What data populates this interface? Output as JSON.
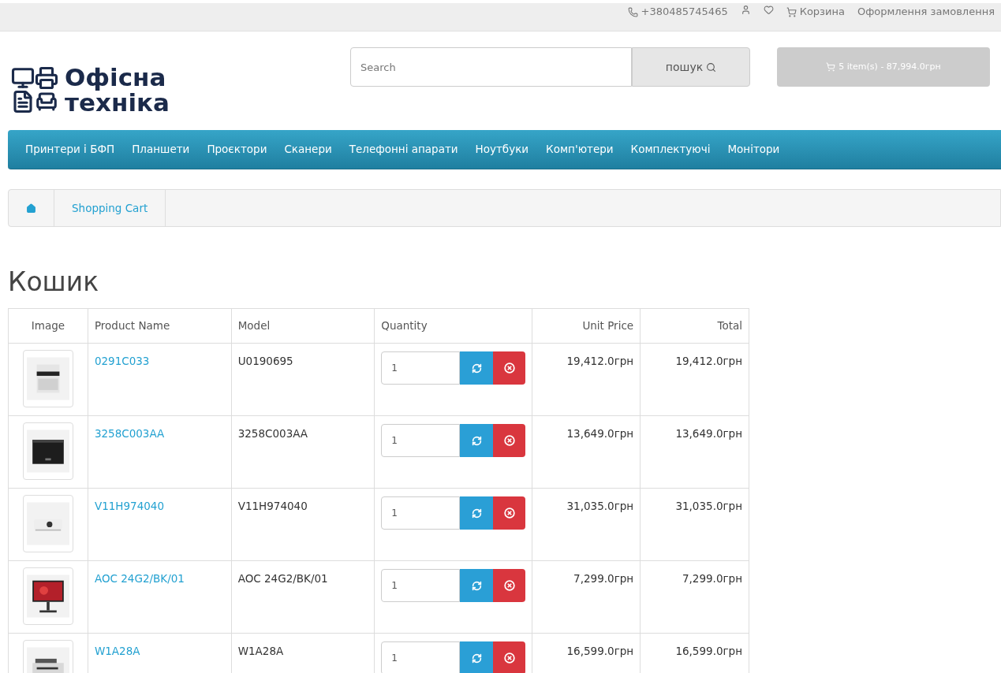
{
  "top_links": [
    {
      "kind": "phone",
      "label": "+380485745465"
    },
    {
      "kind": "account"
    },
    {
      "kind": "wishlist"
    },
    {
      "kind": "cart",
      "label": "Корзина"
    },
    {
      "kind": "checkout",
      "label": "Оформлення замовлення"
    }
  ],
  "logo": {
    "line1": "Офісна",
    "line2": "техніка"
  },
  "search": {
    "placeholder": "Search",
    "button": "пошук"
  },
  "cart_button": "5 item(s) - 87,994.0грн",
  "nav": [
    "Принтери і БФП",
    "Планшети",
    "Проєктори",
    "Сканери",
    "Телефонні апарати",
    "Ноутбуки",
    "Комп'ютери",
    "Комплектуючі",
    "Монітори"
  ],
  "breadcrumb": [
    "Shopping Cart"
  ],
  "heading": "Кошик",
  "table": {
    "columns": [
      "Image",
      "Product Name",
      "Model",
      "Quantity",
      "Unit Price",
      "Total"
    ],
    "rows": [
      {
        "name": "0291C033",
        "model": "U0190695",
        "quantity": "1",
        "unit_price": "19,412.0грн",
        "total": "19,412.0грн"
      },
      {
        "name": "3258C003AA",
        "model": "3258C003AA",
        "quantity": "1",
        "unit_price": "13,649.0грн",
        "total": "13,649.0грн"
      },
      {
        "name": "V11H974040",
        "model": "V11H974040",
        "quantity": "1",
        "unit_price": "31,035.0грн",
        "total": "31,035.0грн"
      },
      {
        "name": "AOC 24G2/BK/01",
        "model": "AOC 24G2/BK/01",
        "quantity": "1",
        "unit_price": "7,299.0грн",
        "total": "7,299.0грн"
      },
      {
        "name": "W1A28A",
        "model": "W1A28A",
        "quantity": "1",
        "unit_price": "16,599.0грн",
        "total": "16,599.0грн"
      }
    ]
  }
}
